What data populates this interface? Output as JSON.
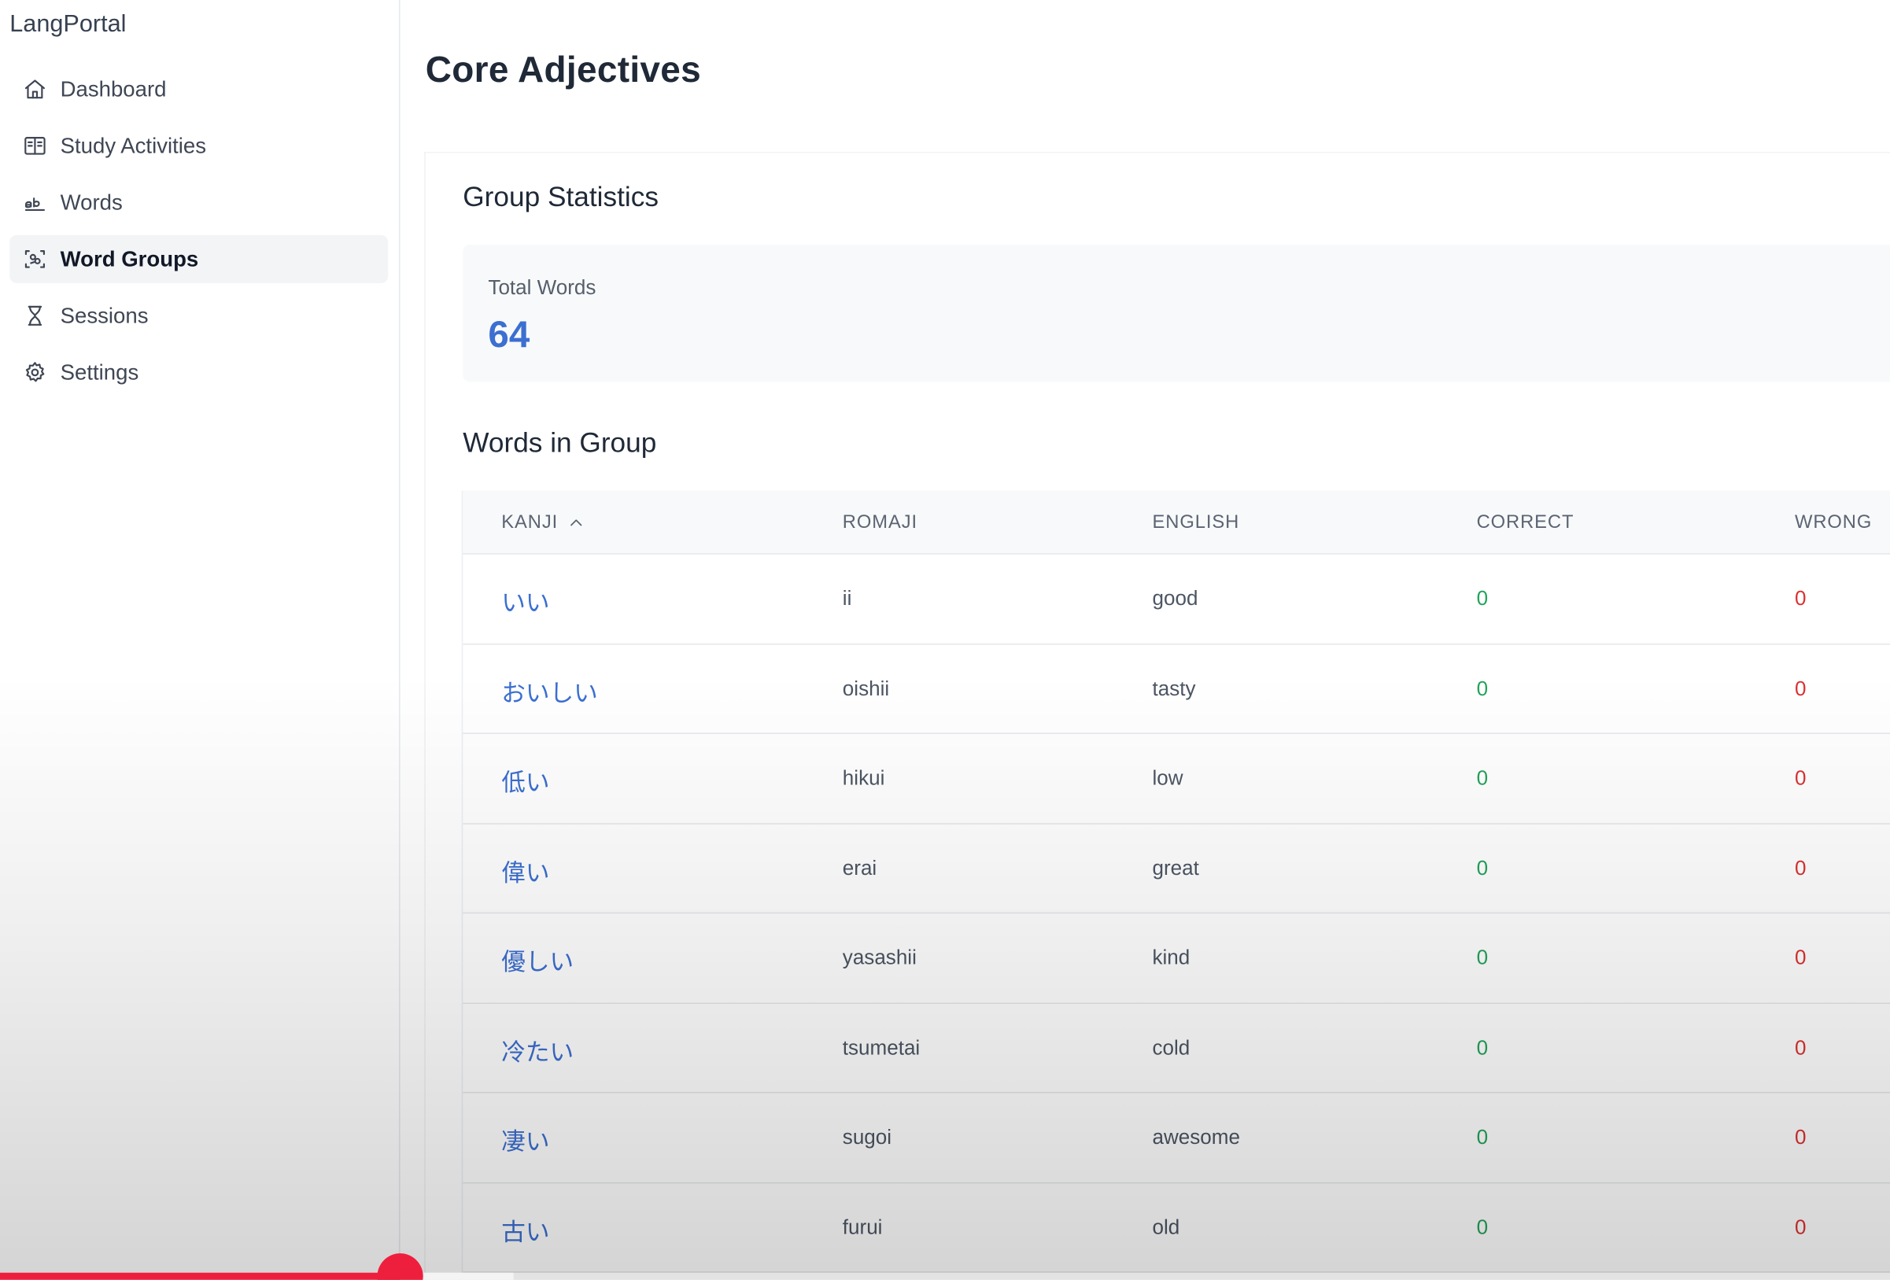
{
  "app": {
    "title": "LangPortal"
  },
  "sidebar": {
    "items": [
      {
        "label": "Dashboard",
        "icon": "home-icon",
        "active": false
      },
      {
        "label": "Study Activities",
        "icon": "book-open-icon",
        "active": false
      },
      {
        "label": "Words",
        "icon": "spell-check-icon",
        "active": false
      },
      {
        "label": "Word Groups",
        "icon": "scan-text-icon",
        "active": true
      },
      {
        "label": "Sessions",
        "icon": "hourglass-icon",
        "active": false
      },
      {
        "label": "Settings",
        "icon": "gear-icon",
        "active": false
      }
    ]
  },
  "page": {
    "title": "Core Adjectives"
  },
  "stats": {
    "heading": "Group Statistics",
    "total_words_label": "Total Words",
    "total_words_value": "64"
  },
  "words": {
    "heading": "Words in Group",
    "columns": {
      "kanji": "KANJI",
      "romaji": "ROMAJI",
      "english": "ENGLISH",
      "correct": "CORRECT",
      "wrong": "WRONG"
    },
    "sort": {
      "column": "kanji",
      "direction": "ascending"
    },
    "rows": [
      {
        "kanji": "いい",
        "romaji": "ii",
        "english": "good",
        "correct": "0",
        "wrong": "0"
      },
      {
        "kanji": "おいしい",
        "romaji": "oishii",
        "english": "tasty",
        "correct": "0",
        "wrong": "0"
      },
      {
        "kanji": "低い",
        "romaji": "hikui",
        "english": "low",
        "correct": "0",
        "wrong": "0"
      },
      {
        "kanji": "偉い",
        "romaji": "erai",
        "english": "great",
        "correct": "0",
        "wrong": "0"
      },
      {
        "kanji": "優しい",
        "romaji": "yasashii",
        "english": "kind",
        "correct": "0",
        "wrong": "0"
      },
      {
        "kanji": "冷たい",
        "romaji": "tsumetai",
        "english": "cold",
        "correct": "0",
        "wrong": "0"
      },
      {
        "kanji": "凄い",
        "romaji": "sugoi",
        "english": "awesome",
        "correct": "0",
        "wrong": "0"
      },
      {
        "kanji": "古い",
        "romaji": "furui",
        "english": "old",
        "correct": "0",
        "wrong": "0"
      }
    ]
  },
  "video_player": {
    "played_fraction": 0.212,
    "buffered_fraction": 0.272,
    "accent_color": "#ee1f3d"
  },
  "colors": {
    "accent_blue": "#3b6fd1",
    "correct_green": "#22a35a",
    "wrong_red": "#dc3030"
  }
}
